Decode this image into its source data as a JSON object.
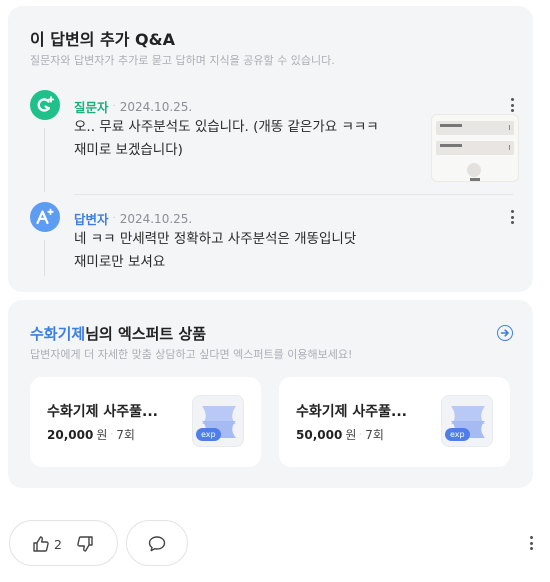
{
  "qa": {
    "title": "이 답변의 추가 Q&A",
    "subtitle": "질문자와 답변자가 추가로 묻고 답하며 지식을 공유할 수 있습니다.",
    "entries": [
      {
        "role": "질문자",
        "date": "2024.10.25.",
        "text": "오.. 무료 사주분석도 있습니다. (개똥 같은가요 ㅋㅋㅋ\n재미로 보겠습니다)",
        "avatar_icon": "question-plus-icon",
        "color": "#1ec18a",
        "has_attachment": true
      },
      {
        "role": "답변자",
        "date": "2024.10.25.",
        "text": "네 ㅋㅋ 만세력만 정확하고 사주분석은 개똥입니닷\n재미로만 보셔요",
        "avatar_icon": "answer-plus-icon",
        "color": "#5c9cf2"
      }
    ]
  },
  "expert": {
    "name": "수화기제",
    "title_suffix": "님의 엑스퍼트 상품",
    "subtitle": "답변자에게 더 자세한 맞춤 상담하고 싶다면 엑스퍼트를 이용해보세요!",
    "accent": "#3d7fe0",
    "products": [
      {
        "title": "수화기제 사주풀...",
        "price": "20,000",
        "unit": "원",
        "count": "7회",
        "badge": "exp"
      },
      {
        "title": "수화기제 사주풀...",
        "price": "50,000",
        "unit": "원",
        "count": "7회",
        "badge": "exp"
      }
    ]
  },
  "reactions": {
    "like_count": "2",
    "like_icon": "thumbs-up-icon",
    "dislike_icon": "thumbs-down-icon",
    "comment_icon": "comment-icon"
  }
}
